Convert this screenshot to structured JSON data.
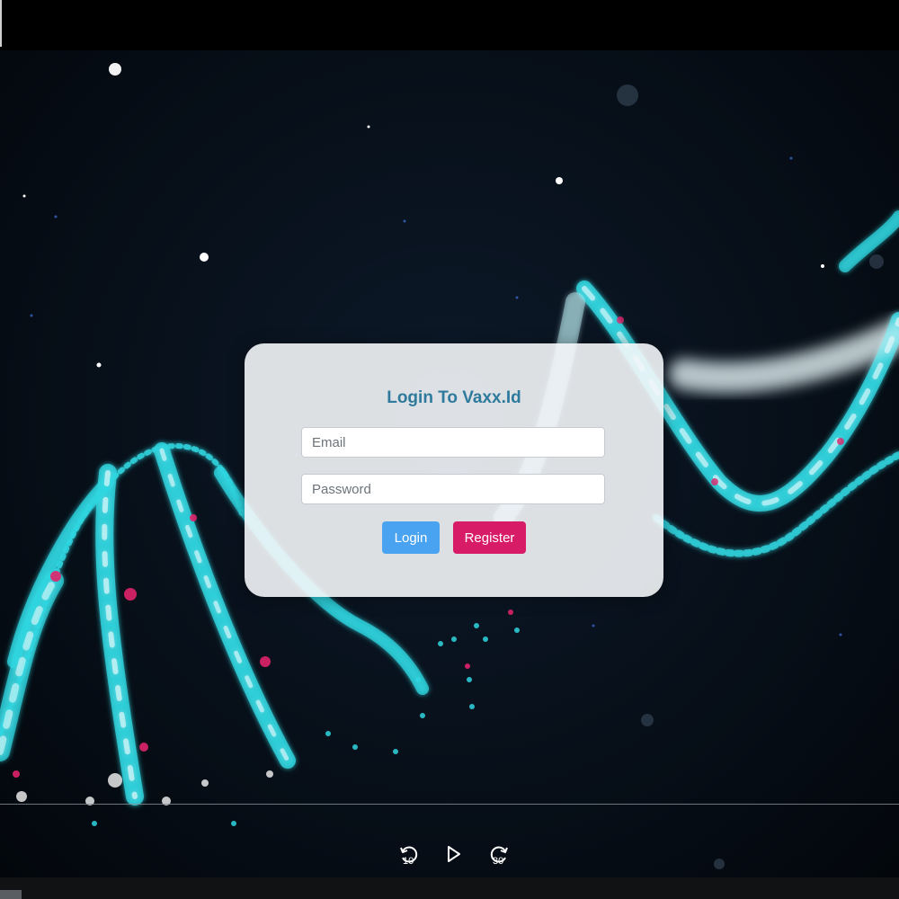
{
  "login": {
    "title": "Login To Vaxx.Id",
    "email_placeholder": "Email",
    "password_placeholder": "Password",
    "login_label": "Login",
    "register_label": "Register"
  },
  "player": {
    "rewind_seconds": "10",
    "forward_seconds": "30",
    "play_icon": "play-icon",
    "rewind_icon": "rewind-10-icon",
    "forward_icon": "forward-30-icon"
  },
  "colors": {
    "title": "#2e7a9c",
    "login_button": "#4aa3f0",
    "register_button": "#d81b66",
    "helix": "#2fd6e0",
    "helix_accent": "#e0236a"
  }
}
